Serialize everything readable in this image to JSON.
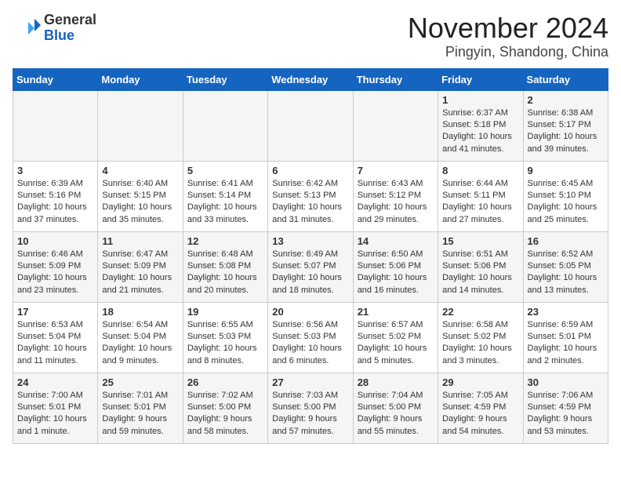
{
  "header": {
    "logo_general": "General",
    "logo_blue": "Blue",
    "month_title": "November 2024",
    "location": "Pingyin, Shandong, China"
  },
  "weekdays": [
    "Sunday",
    "Monday",
    "Tuesday",
    "Wednesday",
    "Thursday",
    "Friday",
    "Saturday"
  ],
  "weeks": [
    [
      {
        "day": "",
        "info": ""
      },
      {
        "day": "",
        "info": ""
      },
      {
        "day": "",
        "info": ""
      },
      {
        "day": "",
        "info": ""
      },
      {
        "day": "",
        "info": ""
      },
      {
        "day": "1",
        "info": "Sunrise: 6:37 AM\nSunset: 5:18 PM\nDaylight: 10 hours and 41 minutes."
      },
      {
        "day": "2",
        "info": "Sunrise: 6:38 AM\nSunset: 5:17 PM\nDaylight: 10 hours and 39 minutes."
      }
    ],
    [
      {
        "day": "3",
        "info": "Sunrise: 6:39 AM\nSunset: 5:16 PM\nDaylight: 10 hours and 37 minutes."
      },
      {
        "day": "4",
        "info": "Sunrise: 6:40 AM\nSunset: 5:15 PM\nDaylight: 10 hours and 35 minutes."
      },
      {
        "day": "5",
        "info": "Sunrise: 6:41 AM\nSunset: 5:14 PM\nDaylight: 10 hours and 33 minutes."
      },
      {
        "day": "6",
        "info": "Sunrise: 6:42 AM\nSunset: 5:13 PM\nDaylight: 10 hours and 31 minutes."
      },
      {
        "day": "7",
        "info": "Sunrise: 6:43 AM\nSunset: 5:12 PM\nDaylight: 10 hours and 29 minutes."
      },
      {
        "day": "8",
        "info": "Sunrise: 6:44 AM\nSunset: 5:11 PM\nDaylight: 10 hours and 27 minutes."
      },
      {
        "day": "9",
        "info": "Sunrise: 6:45 AM\nSunset: 5:10 PM\nDaylight: 10 hours and 25 minutes."
      }
    ],
    [
      {
        "day": "10",
        "info": "Sunrise: 6:46 AM\nSunset: 5:09 PM\nDaylight: 10 hours and 23 minutes."
      },
      {
        "day": "11",
        "info": "Sunrise: 6:47 AM\nSunset: 5:09 PM\nDaylight: 10 hours and 21 minutes."
      },
      {
        "day": "12",
        "info": "Sunrise: 6:48 AM\nSunset: 5:08 PM\nDaylight: 10 hours and 20 minutes."
      },
      {
        "day": "13",
        "info": "Sunrise: 6:49 AM\nSunset: 5:07 PM\nDaylight: 10 hours and 18 minutes."
      },
      {
        "day": "14",
        "info": "Sunrise: 6:50 AM\nSunset: 5:06 PM\nDaylight: 10 hours and 16 minutes."
      },
      {
        "day": "15",
        "info": "Sunrise: 6:51 AM\nSunset: 5:06 PM\nDaylight: 10 hours and 14 minutes."
      },
      {
        "day": "16",
        "info": "Sunrise: 6:52 AM\nSunset: 5:05 PM\nDaylight: 10 hours and 13 minutes."
      }
    ],
    [
      {
        "day": "17",
        "info": "Sunrise: 6:53 AM\nSunset: 5:04 PM\nDaylight: 10 hours and 11 minutes."
      },
      {
        "day": "18",
        "info": "Sunrise: 6:54 AM\nSunset: 5:04 PM\nDaylight: 10 hours and 9 minutes."
      },
      {
        "day": "19",
        "info": "Sunrise: 6:55 AM\nSunset: 5:03 PM\nDaylight: 10 hours and 8 minutes."
      },
      {
        "day": "20",
        "info": "Sunrise: 6:56 AM\nSunset: 5:03 PM\nDaylight: 10 hours and 6 minutes."
      },
      {
        "day": "21",
        "info": "Sunrise: 6:57 AM\nSunset: 5:02 PM\nDaylight: 10 hours and 5 minutes."
      },
      {
        "day": "22",
        "info": "Sunrise: 6:58 AM\nSunset: 5:02 PM\nDaylight: 10 hours and 3 minutes."
      },
      {
        "day": "23",
        "info": "Sunrise: 6:59 AM\nSunset: 5:01 PM\nDaylight: 10 hours and 2 minutes."
      }
    ],
    [
      {
        "day": "24",
        "info": "Sunrise: 7:00 AM\nSunset: 5:01 PM\nDaylight: 10 hours and 1 minute."
      },
      {
        "day": "25",
        "info": "Sunrise: 7:01 AM\nSunset: 5:01 PM\nDaylight: 9 hours and 59 minutes."
      },
      {
        "day": "26",
        "info": "Sunrise: 7:02 AM\nSunset: 5:00 PM\nDaylight: 9 hours and 58 minutes."
      },
      {
        "day": "27",
        "info": "Sunrise: 7:03 AM\nSunset: 5:00 PM\nDaylight: 9 hours and 57 minutes."
      },
      {
        "day": "28",
        "info": "Sunrise: 7:04 AM\nSunset: 5:00 PM\nDaylight: 9 hours and 55 minutes."
      },
      {
        "day": "29",
        "info": "Sunrise: 7:05 AM\nSunset: 4:59 PM\nDaylight: 9 hours and 54 minutes."
      },
      {
        "day": "30",
        "info": "Sunrise: 7:06 AM\nSunset: 4:59 PM\nDaylight: 9 hours and 53 minutes."
      }
    ]
  ]
}
